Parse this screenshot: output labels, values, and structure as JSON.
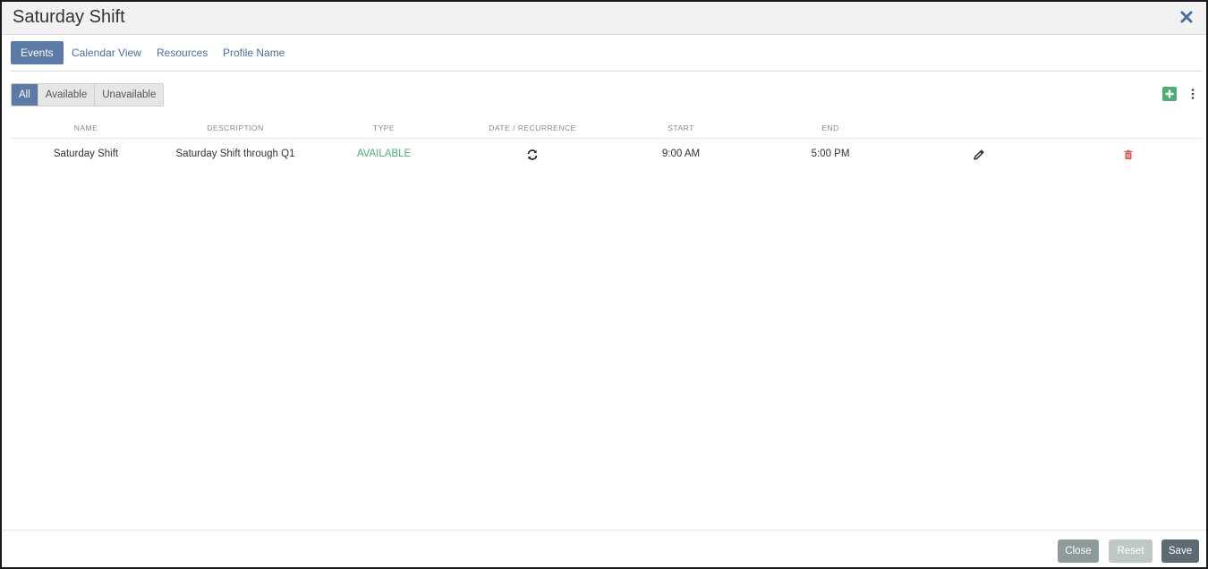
{
  "modal": {
    "title": "Saturday Shift",
    "close_icon": "close-icon"
  },
  "tabs": [
    {
      "label": "Events",
      "active": true
    },
    {
      "label": "Calendar View",
      "active": false
    },
    {
      "label": "Resources",
      "active": false
    },
    {
      "label": "Profile Name",
      "active": false
    }
  ],
  "filters": [
    {
      "label": "All",
      "active": true
    },
    {
      "label": "Available",
      "active": false
    },
    {
      "label": "Unavailable",
      "active": false
    }
  ],
  "toolbar": {
    "add_icon": "plus-square-icon",
    "more_icon": "kebab-menu-icon"
  },
  "table": {
    "columns": [
      "NAME",
      "DESCRIPTION",
      "TYPE",
      "DATE / RECURRENCE",
      "START",
      "END"
    ],
    "rows": [
      {
        "name": "Saturday Shift",
        "description": "Saturday Shift through Q1",
        "type": "AVAILABLE",
        "recurrence_icon": "recurrence-icon",
        "start": "9:00 AM",
        "end": "5:00 PM",
        "edit_icon": "pencil-icon",
        "delete_icon": "trash-icon"
      }
    ]
  },
  "footer": {
    "close_label": "Close",
    "reset_label": "Reset",
    "save_label": "Save"
  },
  "colors": {
    "accent": "#5b7aa6",
    "available": "#4caf72",
    "delete": "#d9534f"
  }
}
